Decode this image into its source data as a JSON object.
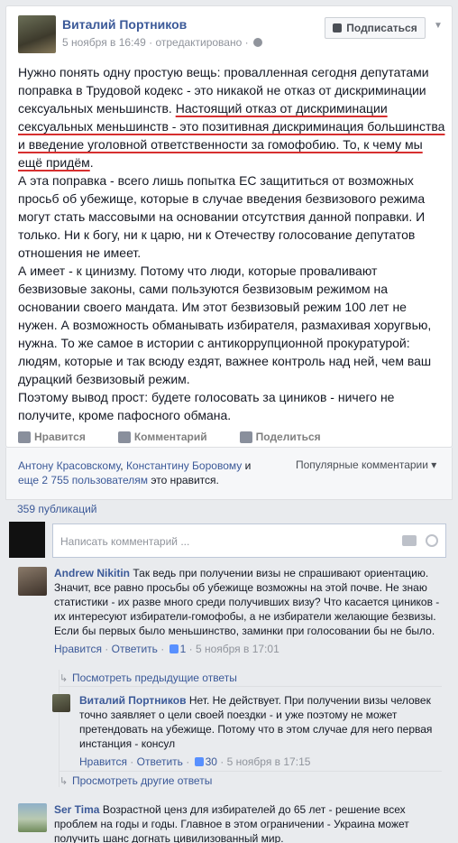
{
  "post": {
    "author": "Виталий Портников",
    "meta_date": "5 ноября в 16:49",
    "meta_edited": " · отредактировано ·",
    "subscribe_label": "Подписаться",
    "paragraphs": [
      {
        "pre": "Нужно понять одну простую вещь: провалленная сегодня депутатами поправка в Трудовой кодекс - это никакой не отказ от дискриминации сексуальных меньшинств. ",
        "hl": "Настоящий отказ от дискриминации сексуальных меньшинств - это позитивная дискриминация большинства и введение уголовной ответственности за гомофобию. То, к чему мы ещё придём",
        "post": "."
      },
      {
        "pre": "А эта поправка - всего лишь попытка ЕС защититься от возможных просьб об убежище, которые в случае введения безвизового режима могут стать массовыми на основании отсутствия данной поправки. И только. Ни к богу, ни к царю, ни к Отечеству голосование депутатов отношения не имеет.",
        "hl": "",
        "post": ""
      },
      {
        "pre": "А имеет - к цинизму. Потому что люди, которые проваливают безвизовые законы, сами пользуются безвизовым режимом на основании своего мандата. Им этот безвизовый режим 100 лет не нужен. А возможность обманывать избирателя, размахивая хоругвью, нужна. То же самое в истории с антикоррупционной прокуратурой: людям, которые и так всюду ездят, важнее контроль над ней, чем ваш дурацкий безвизовый режим.",
        "hl": "",
        "post": ""
      },
      {
        "pre": "Поэтому вывод прост: будете голосовать за циников - ничего не получите, кроме пафосного обмана.",
        "hl": "",
        "post": ""
      }
    ],
    "actions": {
      "like": "Нравится",
      "comment": "Комментарий",
      "share": "Поделиться"
    }
  },
  "likes": {
    "name1": "Антону Красовскому",
    "sep": ", ",
    "name2": "Константину Боровому",
    "and": " и",
    "others": "еще 2 755 пользователям",
    "tail": " это нравится.",
    "popular": "Популярные комментарии ▾"
  },
  "publications": "359 публикаций",
  "comment_input": {
    "placeholder": "Написать комментарий ..."
  },
  "comments": [
    {
      "name": "Andrew Nikitin",
      "text": " Так ведь при получении визы не спрашивают ориентацию. Значит, все равно просьбы об убежище возможны на этой почве. Не знаю статистики - их разве много среди получивших визу? Что касается циников - их интересуют избиратели-гомофобы, а не избиратели желающие безвизы. Если бы первых было меньшинство, заминки при голосовании бы не было.",
      "like": "Нравится",
      "reply": "Ответить",
      "likes": "1",
      "date": "5 ноября в 17:01"
    },
    {
      "name": "Виталий Портников",
      "text": " Нет. Не действует. При получении визы человек точно заявляет о цели своей поездки - и уже поэтому не может претендовать на убежище. Потому что в этом случае для него первая инстанция - консул",
      "like": "Нравится",
      "reply": "Ответить",
      "likes": "30",
      "date": "5 ноября в 17:15"
    },
    {
      "name": "Ser Tima",
      "text": " Возрастной ценз для избирателей до 65 лет - решение всех проблем на годы и годы. Главное в этом ограничении - Украина может получить шанс догнать цивилизованный мир."
    }
  ],
  "view_prev": "Посмотреть предыдущие ответы",
  "view_other": "Просмотреть другие ответы",
  "sep_dot": " · "
}
